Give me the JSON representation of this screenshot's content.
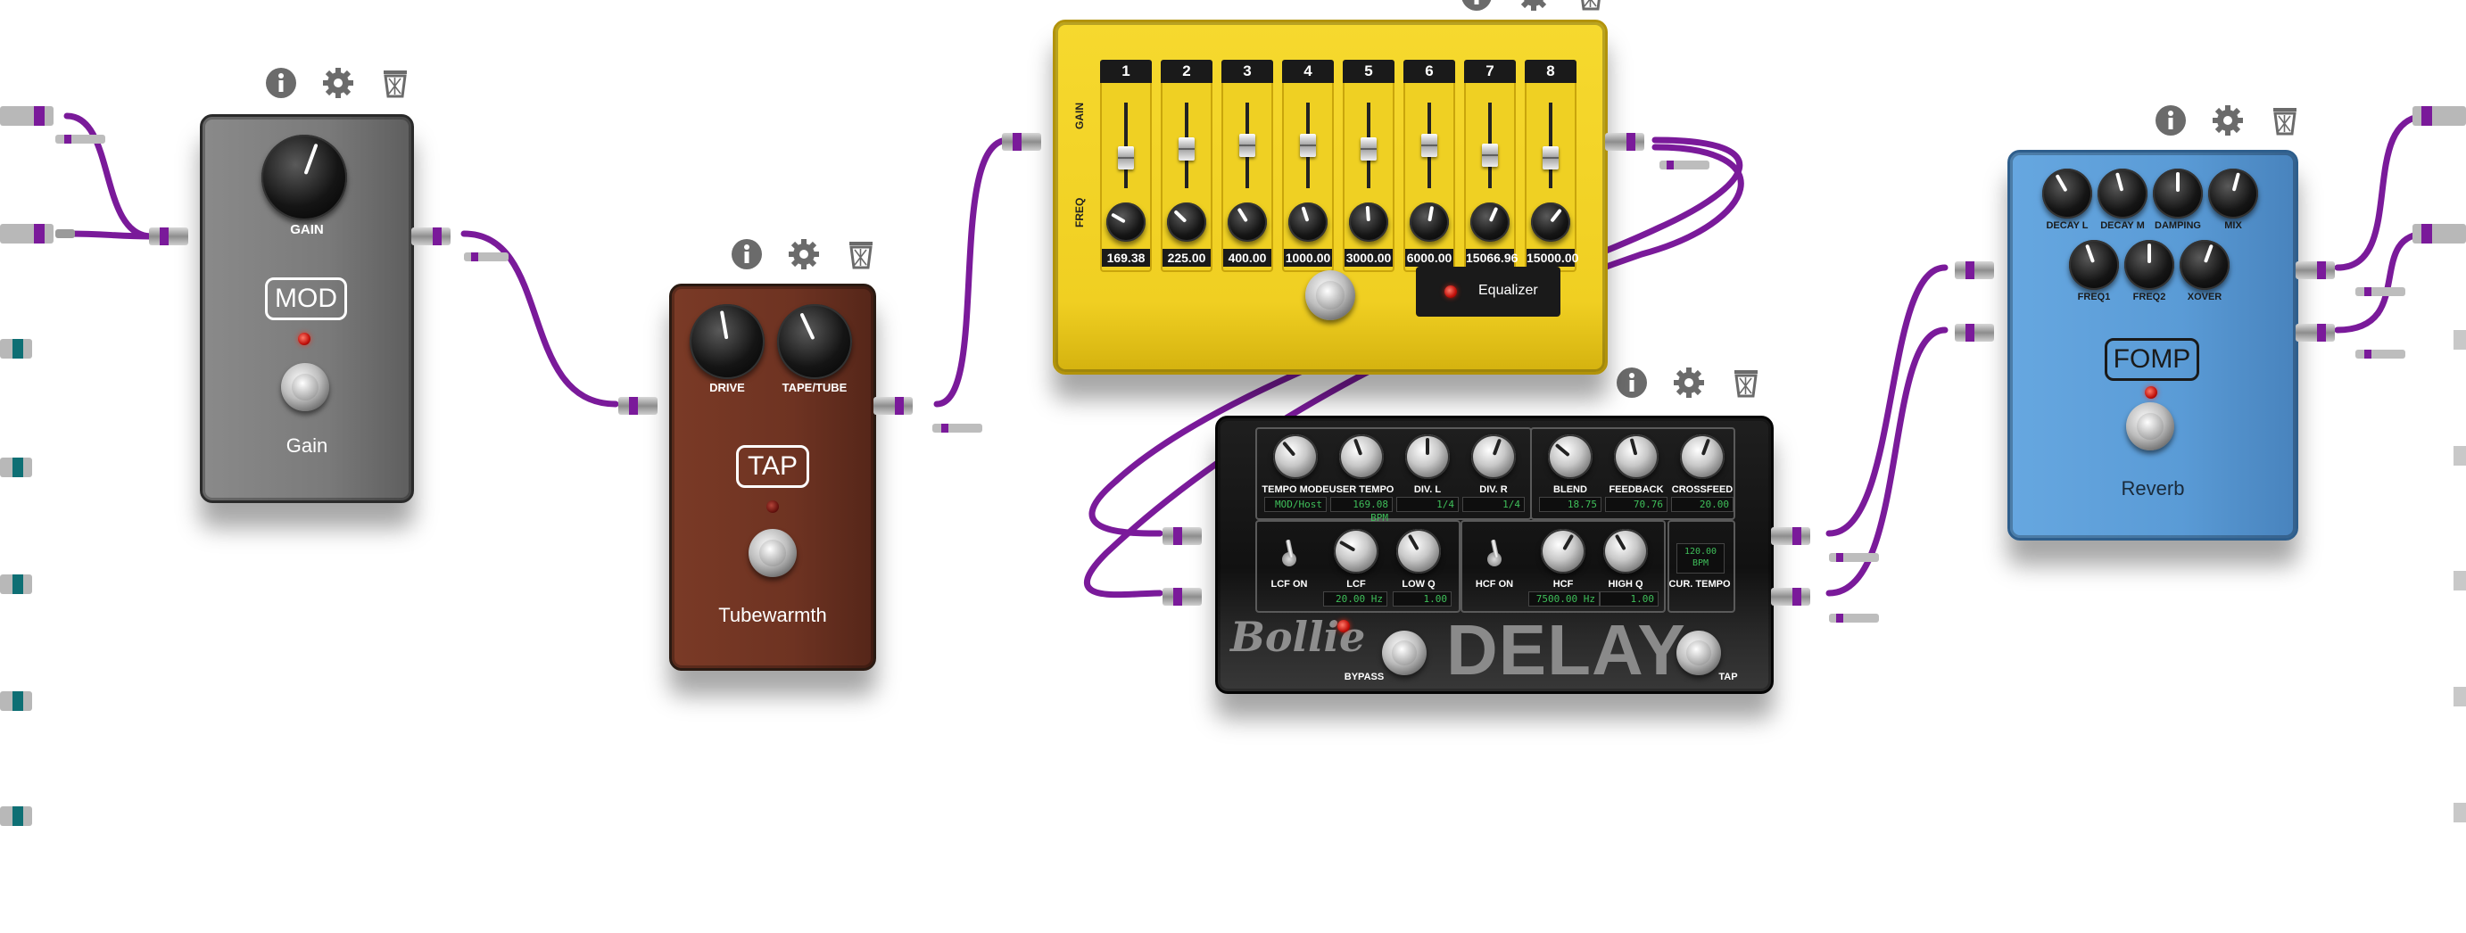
{
  "actions": {
    "info_icon": "info-icon",
    "settings_icon": "gear-icon",
    "delete_icon": "trash-icon"
  },
  "pedals": {
    "gain": {
      "knob_label": "GAIN",
      "brand": "MOD",
      "name": "Gain",
      "color": "#7d7d7d"
    },
    "tubewarmth": {
      "knob_labels": [
        "DRIVE",
        "TAPE/TUBE"
      ],
      "brand": "TAP",
      "name": "Tubewarmth",
      "color": "#6e3322"
    },
    "equalizer": {
      "row_labels": {
        "gain": "GAIN",
        "freq": "FREQ"
      },
      "bands": [
        {
          "num": "1",
          "value": "169.38",
          "gain_level": 0.3
        },
        {
          "num": "2",
          "value": "225.00",
          "gain_level": 0.45
        },
        {
          "num": "3",
          "value": "400.00",
          "gain_level": 0.5
        },
        {
          "num": "4",
          "value": "1000.00",
          "gain_level": 0.5
        },
        {
          "num": "5",
          "value": "3000.00",
          "gain_level": 0.45
        },
        {
          "num": "6",
          "value": "6000.00",
          "gain_level": 0.5
        },
        {
          "num": "7",
          "value": "15066.96",
          "gain_level": 0.35
        },
        {
          "num": "8",
          "value": "15000.00",
          "gain_level": 0.3
        }
      ],
      "name": "Equalizer",
      "color": "#f2d22a"
    },
    "delay": {
      "section1": [
        {
          "label": "TEMPO MODE",
          "value": "MOD/Host"
        },
        {
          "label": "USER TEMPO",
          "value": "169.08 BPM"
        },
        {
          "label": "DIV. L",
          "value": "1/4"
        },
        {
          "label": "DIV. R",
          "value": "1/4"
        }
      ],
      "section2": [
        {
          "label": "BLEND",
          "value": "18.75"
        },
        {
          "label": "FEEDBACK",
          "value": "70.76"
        },
        {
          "label": "CROSSFEED",
          "value": "20.00"
        }
      ],
      "lcf": {
        "switch_label": "LCF ON",
        "knobs": [
          {
            "label": "LCF",
            "value": "20.00 Hz"
          },
          {
            "label": "LOW Q",
            "value": "1.00"
          }
        ]
      },
      "hcf": {
        "switch_label": "HCF ON",
        "knobs": [
          {
            "label": "HCF",
            "value": "7500.00 Hz"
          },
          {
            "label": "HIGH Q",
            "value": "1.00"
          }
        ]
      },
      "tempo_display": {
        "value": "120.00",
        "unit": "BPM",
        "label": "CUR. TEMPO"
      },
      "brand": "Bollie",
      "name": "DELAY",
      "bypass_label": "BYPASS",
      "tap_label": "TAP"
    },
    "reverb": {
      "knob_labels_row1": [
        "DECAY L",
        "DECAY M",
        "DAMPING",
        "MIX"
      ],
      "knob_labels_row2": [
        "FREQ1",
        "FREQ2",
        "XOVER"
      ],
      "brand": "FOMP",
      "name": "Reverb",
      "color": "#5a9bd6"
    }
  },
  "colors": {
    "cable": "#7a1a9a",
    "midi_cable": "#0e6f74"
  }
}
